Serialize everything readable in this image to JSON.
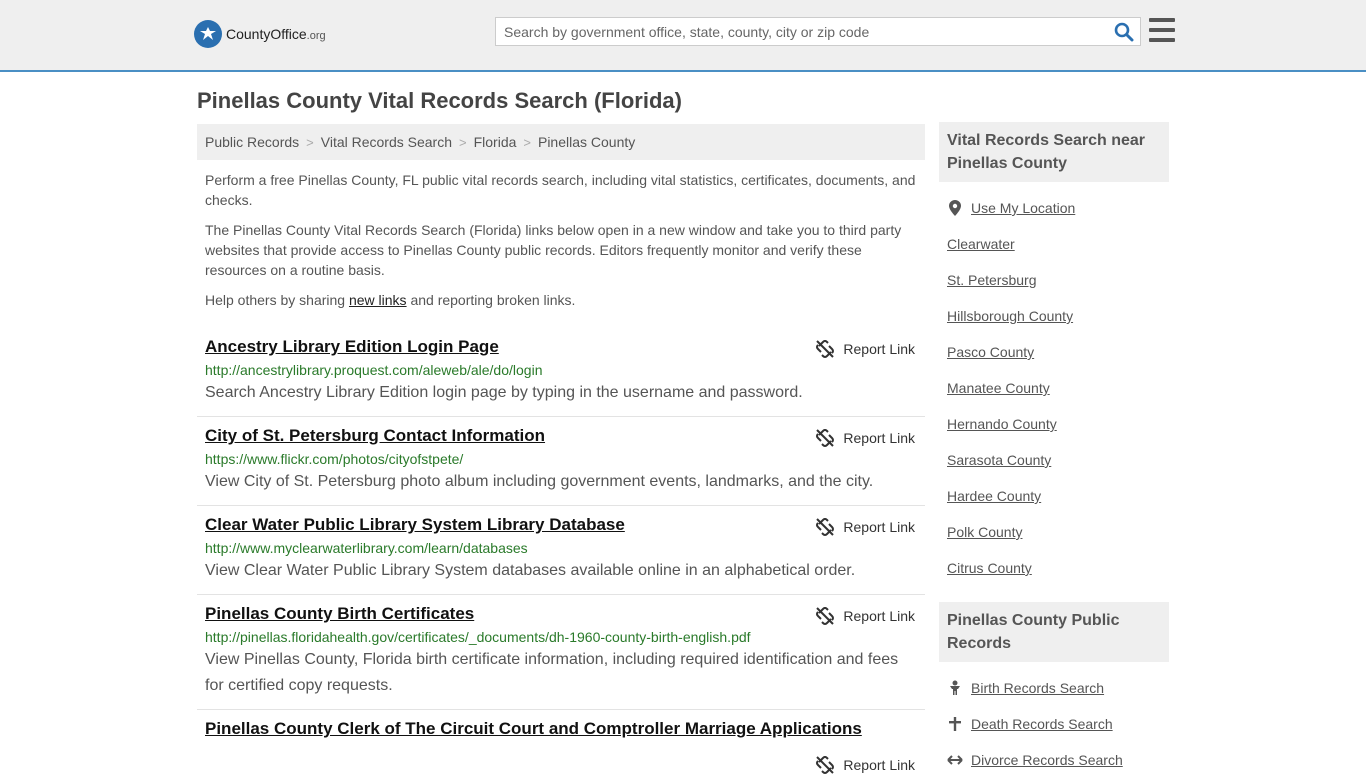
{
  "header": {
    "logo": {
      "name": "CountyOffice",
      "suffix": ".org"
    },
    "search": {
      "placeholder": "Search by government office, state, county, city or zip code"
    }
  },
  "page_title": "Pinellas County Vital Records Search (Florida)",
  "breadcrumb": [
    "Public Records",
    "Vital Records Search",
    "Florida",
    "Pinellas County"
  ],
  "intro": {
    "p1": "Perform a free Pinellas County, FL public vital records search, including vital statistics, certificates, documents, and checks.",
    "p2": "The Pinellas County Vital Records Search (Florida) links below open in a new window and take you to third party websites that provide access to Pinellas County public records. Editors frequently monitor and verify these resources on a routine basis.",
    "p3_before": "Help others by sharing ",
    "p3_link": "new links",
    "p3_after": " and reporting broken links."
  },
  "report_label": "Report Link",
  "results": [
    {
      "title": "Ancestry Library Edition Login Page",
      "url": "http://ancestrylibrary.proquest.com/aleweb/ale/do/login",
      "desc": "Search Ancestry Library Edition login page by typing in the username and password."
    },
    {
      "title": "City of St. Petersburg Contact Information",
      "url": "https://www.flickr.com/photos/cityofstpete/",
      "desc": "View City of St. Petersburg photo album including government events, landmarks, and the city."
    },
    {
      "title": "Clear Water Public Library System Library Database",
      "url": "http://www.myclearwaterlibrary.com/learn/databases",
      "desc": "View Clear Water Public Library System databases available online in an alphabetical order."
    },
    {
      "title": "Pinellas County Birth Certificates",
      "url": "http://pinellas.floridahealth.gov/certificates/_documents/dh-1960-county-birth-english.pdf",
      "desc": "View Pinellas County, Florida birth certificate information, including required identification and fees for certified copy requests."
    },
    {
      "title": "Pinellas County Clerk of The Circuit Court and Comptroller Marriage Applications",
      "url": "",
      "desc": ""
    }
  ],
  "sidebar": {
    "nearby": {
      "heading": "Vital Records Search near Pinellas County",
      "use_location": "Use My Location",
      "items": [
        "Clearwater",
        "St. Petersburg",
        "Hillsborough County",
        "Pasco County",
        "Manatee County",
        "Hernando County",
        "Sarasota County",
        "Hardee County",
        "Polk County",
        "Citrus County"
      ]
    },
    "public_records": {
      "heading": "Pinellas County Public Records",
      "items": [
        "Birth Records Search",
        "Death Records Search",
        "Divorce Records Search"
      ]
    }
  }
}
